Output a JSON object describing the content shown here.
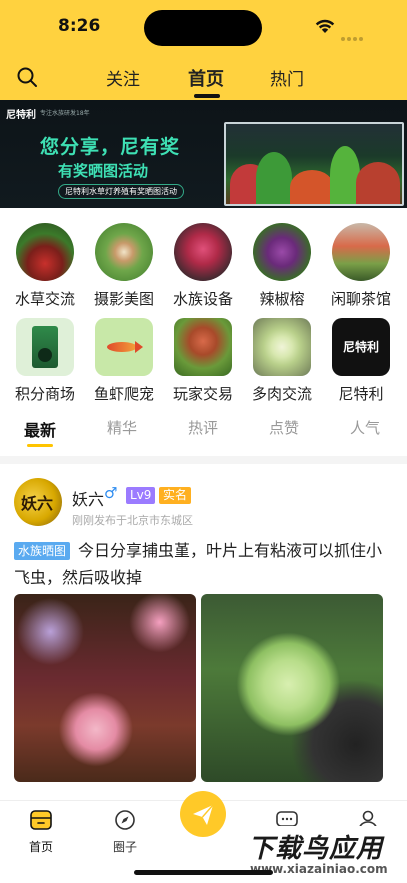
{
  "status_bar": {
    "time": "8:26"
  },
  "header": {
    "tabs": [
      {
        "label": "关注",
        "active": false
      },
      {
        "label": "首页",
        "active": true
      },
      {
        "label": "热门",
        "active": false
      }
    ],
    "accent_color": "#ffd23f"
  },
  "banner": {
    "brand": "尼特利",
    "brand_sub": "专注水族研发18年",
    "title": "您分享，尼有奖",
    "subtitle": "有奖晒图活动",
    "tag": "尼特利水草灯养殖有奖晒图活动"
  },
  "categories": [
    {
      "label": "水草交流",
      "icon": "aquatic-plant-thumb"
    },
    {
      "label": "摄影美图",
      "icon": "shrimp-thumb"
    },
    {
      "label": "水族设备",
      "icon": "red-plant-thumb"
    },
    {
      "label": "辣椒榕",
      "icon": "bucephalandra-thumb"
    },
    {
      "label": "闲聊茶馆",
      "icon": "aquascape-thumb"
    },
    {
      "label": "积分商场",
      "icon": "product-bag-thumb"
    },
    {
      "label": "鱼虾爬宠",
      "icon": "fish-thumb"
    },
    {
      "label": "玩家交易",
      "icon": "stem-plant-thumb"
    },
    {
      "label": "多肉交流",
      "icon": "succulent-thumb"
    },
    {
      "label": "尼特利",
      "icon": "brand-logo-thumb"
    }
  ],
  "feed_tabs": [
    {
      "label": "最新",
      "active": true
    },
    {
      "label": "精华",
      "active": false
    },
    {
      "label": "热评",
      "active": false
    },
    {
      "label": "点赞",
      "active": false
    },
    {
      "label": "人气",
      "active": false
    }
  ],
  "post": {
    "avatar_text": "妖六",
    "username": "妖六",
    "gender": "♂",
    "level": "Lv9",
    "verified": "实名",
    "meta": "刚刚发布于北京市东城区",
    "tag": "水族晒图",
    "text": "今日分享捕虫堇，叶片上有粘液可以抓住小飞虫，然后吸收掉"
  },
  "bottom_tabs": [
    {
      "label": "首页",
      "icon": "home-icon",
      "active": true
    },
    {
      "label": "圈子",
      "icon": "compass-icon",
      "active": false
    },
    {
      "label": "消息",
      "icon": "chat-icon",
      "active": false
    },
    {
      "label": "我的",
      "icon": "profile-icon",
      "active": false
    }
  ],
  "watermark": {
    "main": "下载鸟应用",
    "sub": "www.xiazainiao.com"
  }
}
